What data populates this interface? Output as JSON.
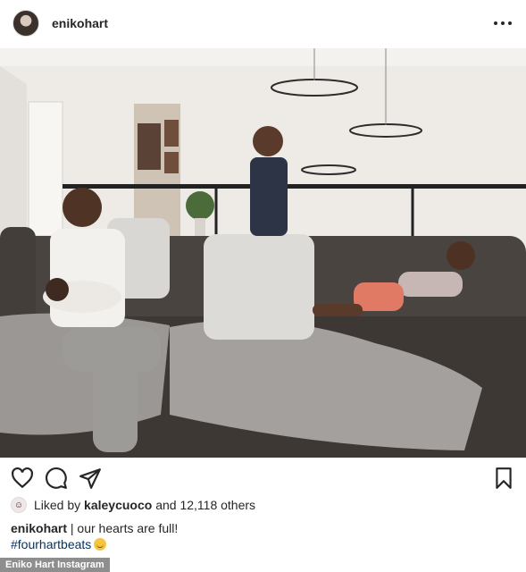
{
  "header": {
    "username": "enikohart",
    "avatar_icon": "profile-avatar",
    "more_icon": "more-horizontal-icon"
  },
  "photo": {
    "description_icon": "post-photo"
  },
  "actions": {
    "like_icon": "heart-icon",
    "comment_icon": "comment-bubble-icon",
    "share_icon": "paper-plane-icon",
    "save_icon": "bookmark-icon"
  },
  "likes": {
    "prefix": "Liked by",
    "user": "kaleycuoco",
    "suffix": "and 12,118 others"
  },
  "caption": {
    "username": "enikohart",
    "text": "| our hearts are full!",
    "hashtag": "#fourhartbeats"
  },
  "credit": "Eniko Hart Instagram",
  "colors": {
    "text": "#262626",
    "hashtag": "#003569",
    "sofa": "#4a4440",
    "blanket": "#9a9794",
    "wall": "#eeebe7"
  }
}
